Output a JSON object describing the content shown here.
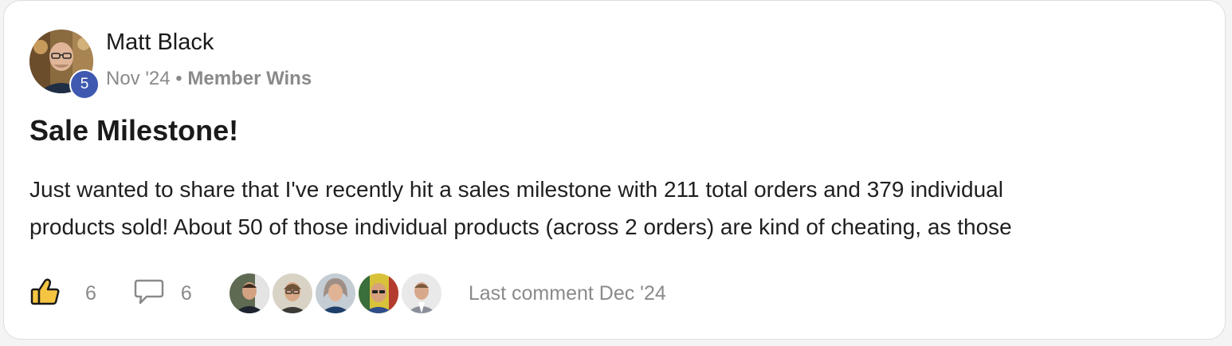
{
  "post": {
    "author": {
      "name": "Matt Black",
      "level": "5"
    },
    "date": "Nov '24",
    "separator": "•",
    "category": "Member Wins",
    "title": "Sale Milestone!",
    "excerpt_lines": [
      "Just wanted to share that I've recently hit a sales milestone with 211 total orders and 379 individual",
      "products sold! About 50 of those individual products (across 2 orders) are kind of cheating, as those"
    ],
    "likes": "6",
    "comments": "6",
    "last_comment": "Last comment Dec '24"
  },
  "icons": {
    "like": "thumbs-up-icon",
    "comment": "comment-bubble-icon"
  },
  "colors": {
    "level_badge": "#3f59b1",
    "thumb": "#f5c542",
    "muted_text": "#8a8a8a"
  }
}
